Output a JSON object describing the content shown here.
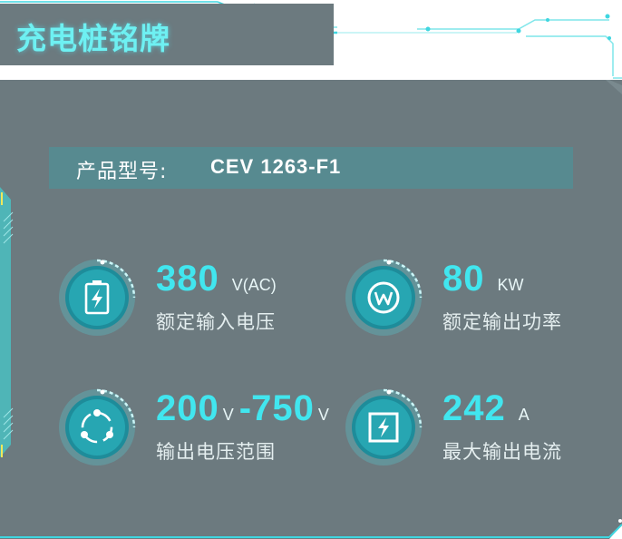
{
  "header": {
    "title": "充电桩铭牌"
  },
  "model": {
    "label": "产品型号:",
    "value": "CEV 1263-F1"
  },
  "specs": {
    "input_voltage": {
      "value": "380",
      "unit": "V(AC)",
      "label": "额定输入电压",
      "icon": "battery-charging-icon"
    },
    "output_power": {
      "value": "80",
      "unit": "KW",
      "label": "额定输出功率",
      "icon": "watt-icon"
    },
    "voltage_range": {
      "min": "200",
      "min_unit": "V",
      "separator": "-",
      "max": "750",
      "max_unit": "V",
      "label": "输出电压范围",
      "icon": "cycle-icon"
    },
    "max_current": {
      "value": "242",
      "unit": "A",
      "label": "最大输出电流",
      "icon": "power-box-icon"
    }
  },
  "colors": {
    "accent": "#41e6ef",
    "panel": "#6c7a7f",
    "model_bar": "#578a90"
  }
}
